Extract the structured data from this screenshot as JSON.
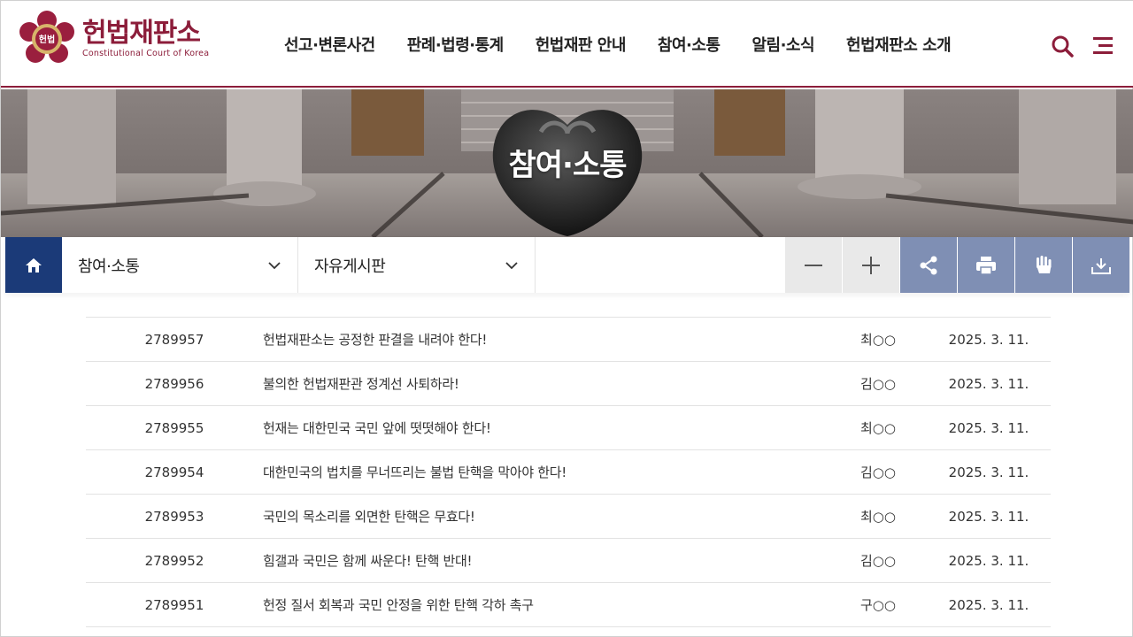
{
  "header": {
    "logo_ko": "헌법재판소",
    "logo_en": "Constitutional Court of Korea",
    "emblem_text": "헌법",
    "nav": [
      "선고·변론사건",
      "판례·법령·통계",
      "헌법재판 안내",
      "참여·소통",
      "알림·소식",
      "헌법재판소 소개"
    ],
    "icons": [
      "search-icon",
      "menu-icon"
    ]
  },
  "hero": {
    "title": "참여·소통"
  },
  "subnav": {
    "home_icon": "home-icon",
    "dropdown1": "참여·소통",
    "dropdown2": "자유게시판",
    "tools": [
      "zoom-out-icon",
      "zoom-in-icon",
      "share-icon",
      "print-icon",
      "hand-icon",
      "download-icon"
    ]
  },
  "board": {
    "rows": [
      {
        "no": "2789957",
        "title": "헌법재판소는 공정한 판결을 내려야 한다!",
        "author": "최○○",
        "date": "2025. 3. 11."
      },
      {
        "no": "2789956",
        "title": "불의한 헌법재판관 정계선 사퇴하라!",
        "author": "김○○",
        "date": "2025. 3. 11."
      },
      {
        "no": "2789955",
        "title": "헌재는 대한민국 국민 앞에 떳떳해야 한다!",
        "author": "최○○",
        "date": "2025. 3. 11."
      },
      {
        "no": "2789954",
        "title": "대한민국의 법치를 무너뜨리는 불법 탄핵을 막아야 한다!",
        "author": "김○○",
        "date": "2025. 3. 11."
      },
      {
        "no": "2789953",
        "title": "국민의 목소리를 외면한 탄핵은 무효다!",
        "author": "최○○",
        "date": "2025. 3. 11."
      },
      {
        "no": "2789952",
        "title": "힘갤과 국민은 함께 싸운다! 탄핵 반대!",
        "author": "김○○",
        "date": "2025. 3. 11."
      },
      {
        "no": "2789951",
        "title": "헌정 질서 회복과 국민 안정을 위한 탄핵 각하 촉구",
        "author": "구○○",
        "date": "2025. 3. 11."
      }
    ]
  },
  "colors": {
    "brand": "#8c1d3a",
    "navy": "#1b3a78",
    "tool_blue": "#7f8fb4"
  }
}
